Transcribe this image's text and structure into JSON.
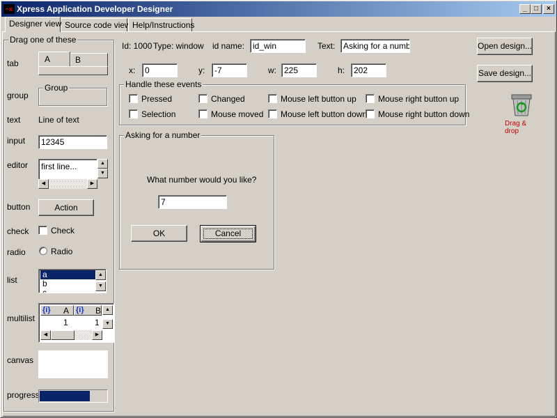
{
  "window": {
    "title": "Xpress Application Developer Designer",
    "icon": "app-icon"
  },
  "caption_buttons": {
    "minimize": "_",
    "maximize": "□",
    "close": "×"
  },
  "tabs": [
    {
      "label": "Designer view",
      "active": true
    },
    {
      "label": "Source code view",
      "active": false
    },
    {
      "label": "Help/Instructions",
      "active": false
    }
  ],
  "palette": {
    "legend": "Drag one of these",
    "tab": {
      "label": "tab",
      "tab_a": "A",
      "tab_b": "B"
    },
    "group": {
      "label": "group",
      "caption": "Group"
    },
    "text": {
      "label": "text",
      "value": "Line of text"
    },
    "input": {
      "label": "input",
      "value": "12345"
    },
    "editor": {
      "label": "editor",
      "value": "first line..."
    },
    "button": {
      "label": "button",
      "caption": "Action"
    },
    "check": {
      "label": "check",
      "caption": "Check"
    },
    "radio": {
      "label": "radio",
      "caption": "Radio"
    },
    "list": {
      "label": "list",
      "items": [
        "a",
        "b",
        "c"
      ],
      "selected": 0
    },
    "multilist": {
      "label": "multilist",
      "col1": "A",
      "col2": "B",
      "header_icon": "{i}",
      "row": [
        "1",
        "1"
      ]
    },
    "canvas": {
      "label": "canvas"
    },
    "progress": {
      "label": "progress",
      "value": 0.75
    }
  },
  "properties": {
    "id_label": "Id: 1000",
    "type_label": "Type: window",
    "id_name_label": "id name:",
    "id_name_value": "id_win",
    "text_label": "Text:",
    "text_value": "Asking for a number",
    "x_label": "x:",
    "x_value": "0",
    "y_label": "y:",
    "y_value": "-7",
    "w_label": "w:",
    "w_value": "225",
    "h_label": "h:",
    "h_value": "202"
  },
  "events": {
    "legend": "Handle these events",
    "items": [
      "Pressed",
      "Changed",
      "Mouse left button up",
      "Mouse right button up",
      "Selection",
      "Mouse moved",
      "Mouse left button down",
      "Mouse right button down"
    ]
  },
  "actions": {
    "open": "Open design...",
    "save": "Save design...",
    "trash_label": "Drag & drop",
    "trash_color": "#cc0000"
  },
  "preview": {
    "legend": "Asking for a number",
    "prompt": "What number would you like?",
    "input_value": "7",
    "ok": "OK",
    "cancel": "Cancel"
  },
  "colors": {
    "title_start": "#0a246a",
    "title_end": "#a6caf0",
    "selection": "#0a246a",
    "face": "#d4d0c8"
  }
}
